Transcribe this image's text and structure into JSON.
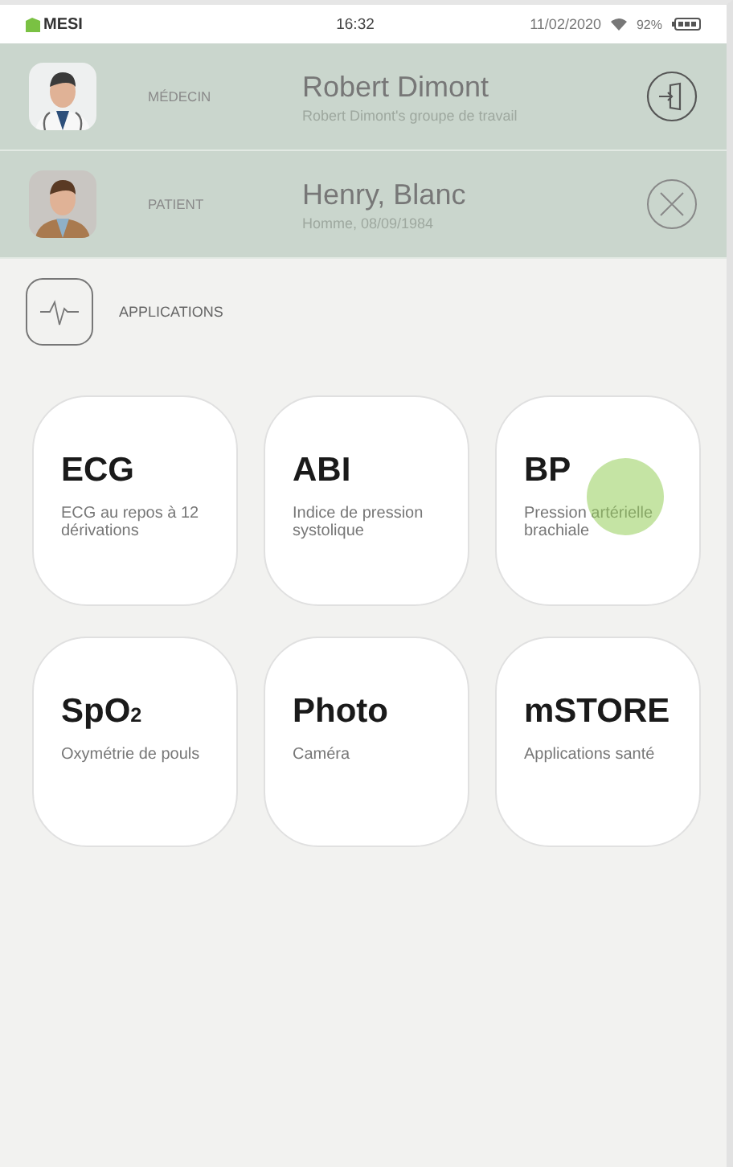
{
  "status_bar": {
    "carrier": "MESI",
    "time": "16:32",
    "date": "11/02/2020",
    "battery": "92%"
  },
  "people": [
    {
      "kind": "doctor",
      "role": "MÉDECIN",
      "name": "Robert Dimont",
      "detail": "Robert Dimont's groupe de travail"
    },
    {
      "kind": "patient",
      "role": "PATIENT",
      "name": "Henry, Blanc",
      "detail": "Homme, 08/09/1984"
    }
  ],
  "section": {
    "title": "APPLICATIONS"
  },
  "apps": [
    {
      "title": "ECG",
      "description": "ECG au repos à 12 dérivations",
      "touched": false
    },
    {
      "title": "ABI",
      "description": "Indice de pression systolique",
      "touched": false
    },
    {
      "title": "BP",
      "description": "Pression artérielle brachiale",
      "touched": true
    },
    {
      "title": "SpO$_{2}$",
      "description": "Oxymétrie de pouls",
      "touched": false
    },
    {
      "title": "Photo",
      "description": "Caméra",
      "touched": false
    },
    {
      "title": "mSTORE",
      "description": "Applications santé",
      "touched": false
    }
  ]
}
